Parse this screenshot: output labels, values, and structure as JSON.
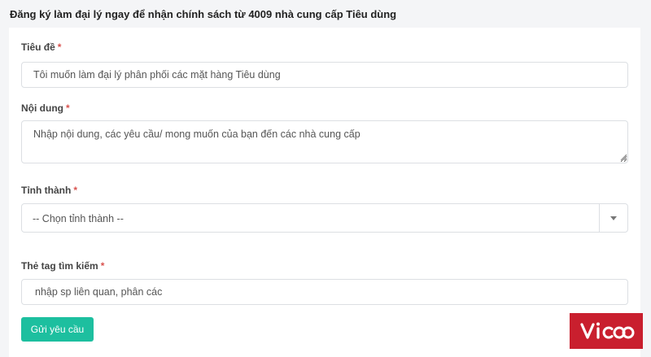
{
  "heading": "Đăng ký làm đại lý ngay để nhận chính sách từ 4009 nhà cung cấp Tiêu dùng",
  "form": {
    "title": {
      "label": "Tiêu đề",
      "required_mark": "*",
      "value": "Tôi muốn làm đại lý phân phối các mặt hàng Tiêu dùng"
    },
    "content": {
      "label": "Nội dung",
      "required_mark": "*",
      "placeholder": "Nhập nội dung, các yêu cầu/ mong muốn của bạn đến các nhà cung cấp"
    },
    "province": {
      "label": "Tỉnh thành",
      "required_mark": "*",
      "selected": "-- Chọn tỉnh thành --"
    },
    "tags": {
      "label": "Thẻ tag tìm kiếm",
      "required_mark": "*",
      "placeholder": "nhập sp liên quan, phân các"
    },
    "submit_label": "Gửi yêu cầu"
  },
  "logo": {
    "text": "vicoo",
    "bg_color": "#c91f2e"
  },
  "colors": {
    "accent": "#1dbf9f",
    "required": "#d9534f"
  },
  "icons": {
    "select_arrow": "caret-down-icon",
    "resize": "resize-grip-icon"
  }
}
